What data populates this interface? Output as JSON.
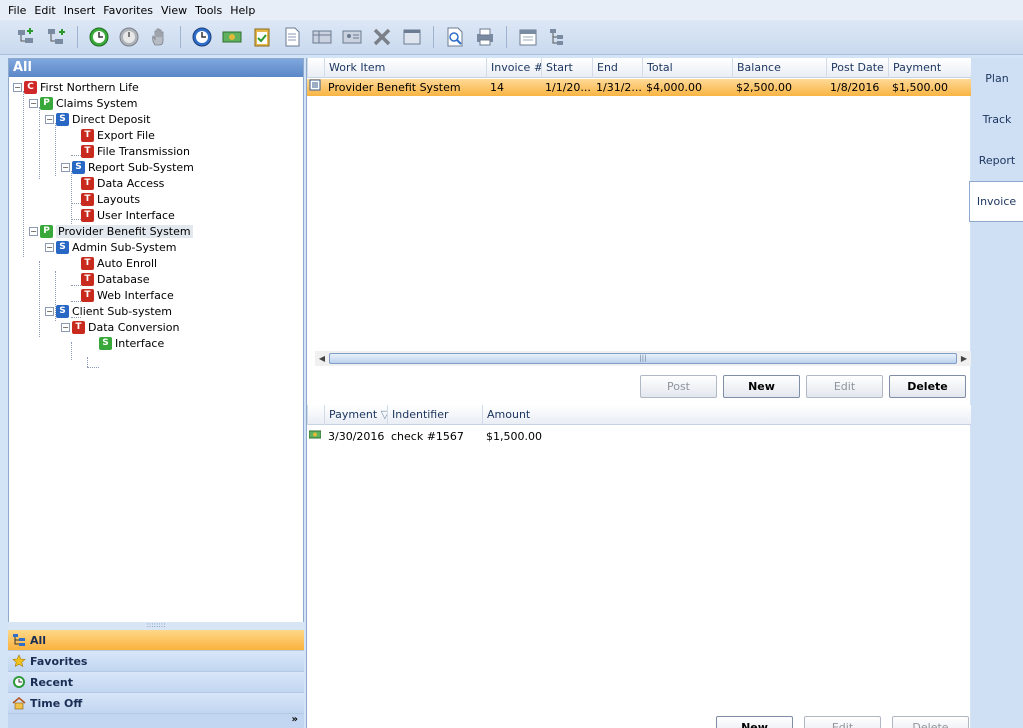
{
  "menu": [
    "File",
    "Edit",
    "Insert",
    "Favorites",
    "View",
    "Tools",
    "Help"
  ],
  "toolbar_icons": [
    "add-item-icon",
    "add-subitem-icon",
    "start-timer-icon",
    "stop-timer-icon",
    "hand-icon",
    "clock-icon",
    "money-icon",
    "clipboard-icon",
    "document-icon",
    "table-icon",
    "card-icon",
    "delete-icon",
    "window-icon",
    "preview-icon",
    "print-icon",
    "calendar-icon",
    "tree-icon"
  ],
  "left": {
    "header": "All",
    "tree": [
      {
        "label": "First Northern Life",
        "type": "C"
      },
      {
        "label": "Claims System",
        "type": "P"
      },
      {
        "label": "Direct Deposit",
        "type": "S"
      },
      {
        "label": "Export File",
        "type": "T"
      },
      {
        "label": "File Transmission",
        "type": "T"
      },
      {
        "label": "Report Sub-System",
        "type": "S"
      },
      {
        "label": "Data Access",
        "type": "T"
      },
      {
        "label": "Layouts",
        "type": "T"
      },
      {
        "label": "User Interface",
        "type": "T"
      },
      {
        "label": "Provider Benefit System",
        "type": "P"
      },
      {
        "label": "Admin Sub-System",
        "type": "S"
      },
      {
        "label": "Auto Enroll",
        "type": "T"
      },
      {
        "label": "Database",
        "type": "T"
      },
      {
        "label": "Web Interface",
        "type": "T"
      },
      {
        "label": "Client Sub-system",
        "type": "S"
      },
      {
        "label": "Data Conversion",
        "type": "T"
      },
      {
        "label": "Interface",
        "type": "S"
      }
    ],
    "nav": [
      "All",
      "Favorites",
      "Recent",
      "Time Off"
    ]
  },
  "invoices": {
    "columns": [
      "Work Item",
      "Invoice #",
      "Start",
      "End",
      "Total",
      "Balance",
      "Post Date",
      "Payment"
    ],
    "rows": [
      [
        "Provider Benefit System",
        "14",
        "1/1/20...",
        "1/31/2...",
        "$4,000.00",
        "$2,500.00",
        "1/8/2016",
        "$1,500.00"
      ]
    ],
    "buttons": {
      "post": "Post",
      "new": "New",
      "edit": "Edit",
      "delete": "Delete"
    }
  },
  "payments": {
    "columns": [
      "Payment",
      "Indentifier",
      "Amount"
    ],
    "rows": [
      [
        "3/30/2016",
        "check #1567",
        "$1,500.00"
      ]
    ],
    "buttons": {
      "new": "New",
      "edit": "Edit",
      "delete": "Delete"
    }
  },
  "tabs": [
    "Plan",
    "Track",
    "Report",
    "Invoice"
  ],
  "colors": {
    "selection": "#f8b443",
    "accent": "#5b86c7"
  }
}
